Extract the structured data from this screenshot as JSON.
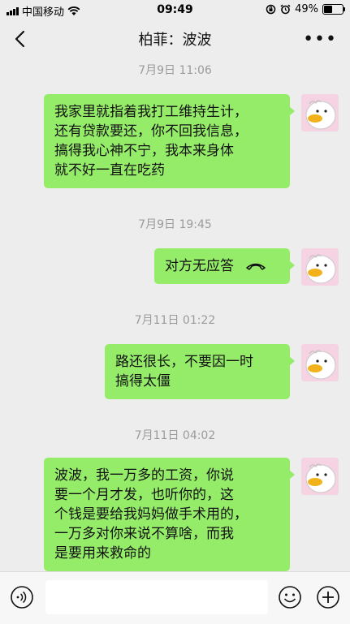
{
  "status_bar": {
    "carrier": "中国移动",
    "time": "09:49",
    "battery_text": "49%",
    "battery_level": 0.49
  },
  "nav": {
    "title": "柏菲：波波"
  },
  "messages": [
    {
      "timestamp": "7月9日 11:06",
      "lines": [
        "我家里就指着我打工维持生计，",
        "还有贷款要还，你不回我信息，",
        "搞得我心神不宁，我本来身体",
        "就不好一直在吃药"
      ]
    },
    {
      "timestamp": "7月9日 19:45",
      "call_text": "对方无应答"
    },
    {
      "timestamp": "7月11日 01:22",
      "lines": [
        "路还很长，不要因一时",
        "搞得太僵"
      ]
    },
    {
      "timestamp": "7月11日 04:02",
      "lines": [
        "波波，我一万多的工资，你说",
        "要一个月才发，也听你的，这",
        "个钱是要给我妈妈做手术用的，",
        "一万多对你来说不算啥，而我",
        "是要用来救命的"
      ]
    }
  ],
  "colors": {
    "bubble": "#95ec69",
    "background": "#ededed",
    "timestamp": "#9b9b9b"
  },
  "icons": [
    "back-icon",
    "more-icon",
    "voice-icon",
    "emoji-icon",
    "plus-icon",
    "phone-icon",
    "avatar-duck"
  ]
}
